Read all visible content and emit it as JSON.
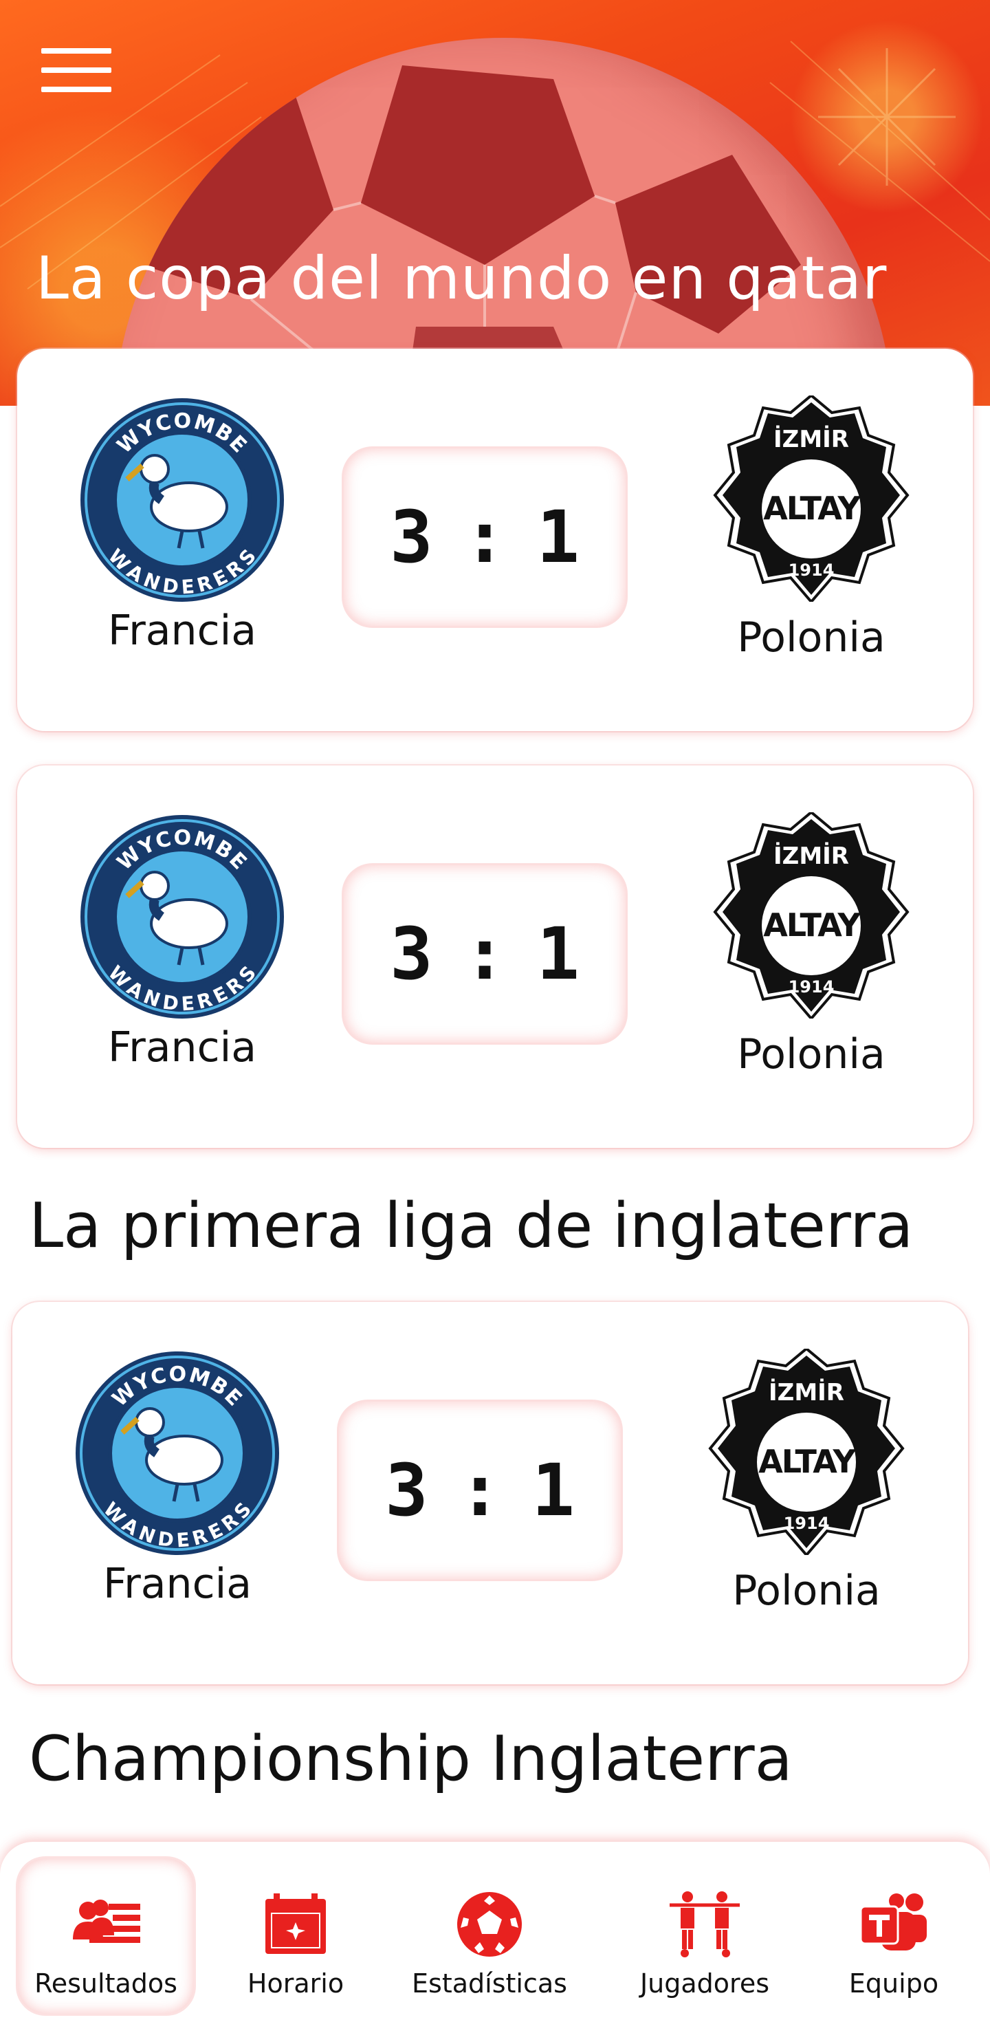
{
  "header": {
    "title": "La copa del mundo en qatar",
    "menu_icon": "hamburger-menu-icon"
  },
  "sections": [
    {
      "title": "",
      "matches": [
        {
          "home": {
            "name": "Francia",
            "logo_text_top": "WYCOMBE",
            "logo_text_bottom": "WANDERERS"
          },
          "away": {
            "name": "Polonia",
            "logo_text_top": "İZMİR",
            "logo_text_mid": "ALTAY",
            "logo_text_bottom": "1914"
          },
          "score_home": "3",
          "score_sep": ":",
          "score_away": "1"
        },
        {
          "home": {
            "name": "Francia",
            "logo_text_top": "WYCOMBE",
            "logo_text_bottom": "WANDERERS"
          },
          "away": {
            "name": "Polonia",
            "logo_text_top": "İZMİR",
            "logo_text_mid": "ALTAY",
            "logo_text_bottom": "1914"
          },
          "score_home": "3",
          "score_sep": ":",
          "score_away": "1"
        }
      ]
    },
    {
      "title": "La primera liga de inglaterra",
      "matches": [
        {
          "home": {
            "name": "Francia",
            "logo_text_top": "WYCOMBE",
            "logo_text_bottom": "WANDERERS"
          },
          "away": {
            "name": "Polonia",
            "logo_text_top": "İZMİR",
            "logo_text_mid": "ALTAY",
            "logo_text_bottom": "1914"
          },
          "score_home": "3",
          "score_sep": ":",
          "score_away": "1"
        }
      ]
    },
    {
      "title": "Championship Inglaterra",
      "matches": []
    }
  ],
  "nav": {
    "items": [
      {
        "label": "Resultados",
        "icon": "results-icon",
        "active": true
      },
      {
        "label": "Horario",
        "icon": "calendar-icon",
        "active": false
      },
      {
        "label": "Estadísticas",
        "icon": "soccer-ball-icon",
        "active": false
      },
      {
        "label": "Jugadores",
        "icon": "players-icon",
        "active": false
      },
      {
        "label": "Equipo",
        "icon": "team-icon",
        "active": false
      }
    ]
  },
  "colors": {
    "accent": "#e8211f",
    "hero_orange": "#f24a16",
    "ball": "#ef837a",
    "wycombe_dark": "#173a6b",
    "wycombe_light": "#4fb3e6",
    "altay": "#111111"
  }
}
